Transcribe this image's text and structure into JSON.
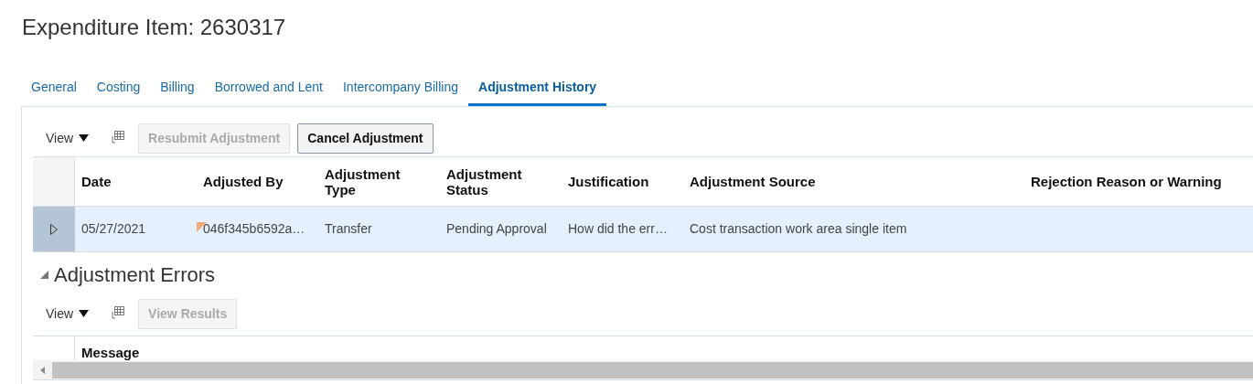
{
  "title": "Expenditure Item: 2630317",
  "tabs": [
    {
      "label": "General",
      "selected": false
    },
    {
      "label": "Costing",
      "selected": false
    },
    {
      "label": "Billing",
      "selected": false
    },
    {
      "label": "Borrowed and Lent",
      "selected": false
    },
    {
      "label": "Intercompany Billing",
      "selected": false
    },
    {
      "label": "Adjustment History",
      "selected": true
    }
  ],
  "history": {
    "view_menu": "View",
    "buttons": [
      {
        "label": "Resubmit Adjustment",
        "disabled": true
      },
      {
        "label": "Cancel Adjustment",
        "disabled": false
      }
    ],
    "columns": [
      "Date",
      "Adjusted By",
      "Adjustment Type",
      "Adjustment Status",
      "Justification",
      "Adjustment Source",
      "Rejection Reason or Warning"
    ],
    "rows": [
      {
        "selected": true,
        "cells": [
          "05/27/2021",
          "046f345b6592a…",
          "Transfer",
          "Pending Approval",
          "How did the err…",
          "Cost transaction work area single item",
          ""
        ]
      }
    ]
  },
  "errors": {
    "title": "Adjustment Errors",
    "expanded": true,
    "view_menu": "View",
    "buttons": [
      {
        "label": "View Results",
        "disabled": true
      }
    ],
    "columns": [
      "Message"
    ]
  }
}
